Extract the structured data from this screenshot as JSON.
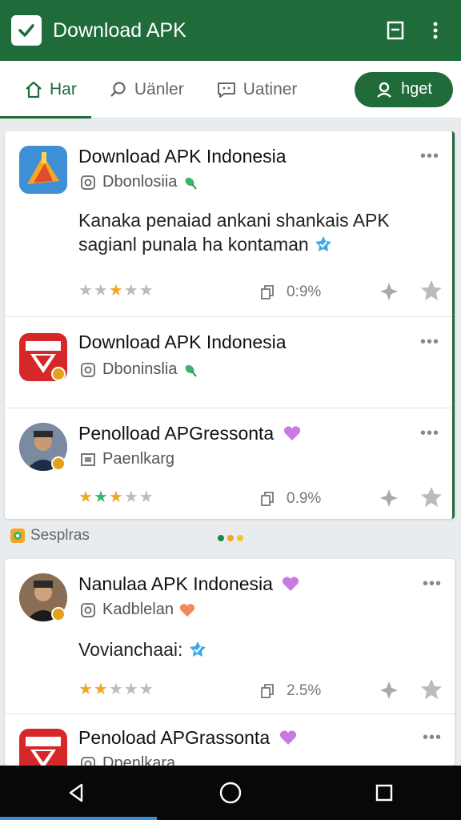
{
  "appbar": {
    "title": "Download APK",
    "accent": "#1f6b3a"
  },
  "tabs": [
    {
      "label": "Har",
      "icon": "home-icon",
      "active": true
    },
    {
      "label": "Uänler",
      "icon": "search-icon",
      "active": false
    },
    {
      "label": "Uatiner",
      "icon": "chat-icon",
      "active": false
    },
    {
      "label": "hget",
      "icon": "person-icon",
      "active": false
    }
  ],
  "items": [
    {
      "title": "Download APK Indonesia",
      "subtitle": "Dbonlosiia",
      "description": "Kanaka penaiad ankani shankais APK sagianl punala ha kontaman",
      "rating": 3,
      "stat": "0:9%",
      "icon": "app-icon-orange"
    },
    {
      "title": "Download APK Indonesia",
      "subtitle": "Dboninslia",
      "icon": "app-icon-red"
    },
    {
      "title": "Penolload APGressonta",
      "subtitle": "Paenlkarg",
      "rating": 3,
      "stat": "0.9%",
      "icon": "avatar-icon"
    },
    {
      "title": "Nanulaa APK Indonesia",
      "subtitle": "Kadblelan",
      "description": "Vovianchaai:",
      "rating": 2,
      "stat": "2.5%",
      "icon": "avatar-icon"
    },
    {
      "title": "Penoload APGrassonta",
      "subtitle": "Dpenlkara",
      "icon": "app-icon-red"
    }
  ],
  "section": {
    "label": "Sesplras"
  },
  "more_label": "•••",
  "stars_glyph": "★★★★★"
}
